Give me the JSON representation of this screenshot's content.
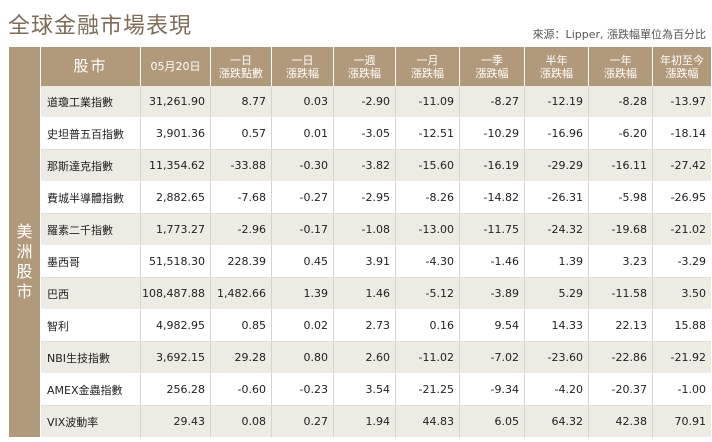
{
  "title": "全球金融市場表現",
  "source": "來源：Lipper, 漲跌幅單位為百分比",
  "region": [
    "美",
    "洲",
    "股",
    "市"
  ],
  "headers": {
    "stock": "股市",
    "date": "05月20日",
    "c1": [
      "一日",
      "漲跌點數"
    ],
    "c2": [
      "一日",
      "漲跌幅"
    ],
    "c3": [
      "一週",
      "漲跌幅"
    ],
    "c4": [
      "一月",
      "漲跌幅"
    ],
    "c5": [
      "一季",
      "漲跌幅"
    ],
    "c6": [
      "半年",
      "漲跌幅"
    ],
    "c7": [
      "一年",
      "漲跌幅"
    ],
    "c8": [
      "年初至今",
      "漲跌幅"
    ]
  },
  "rows": [
    {
      "name": "道瓊工業指數",
      "vals": [
        "31,261.90",
        "8.77",
        "0.03",
        "-2.90",
        "-11.09",
        "-8.27",
        "-12.19",
        "-8.28",
        "-13.97"
      ]
    },
    {
      "name": "史坦普五百指數",
      "vals": [
        "3,901.36",
        "0.57",
        "0.01",
        "-3.05",
        "-12.51",
        "-10.29",
        "-16.96",
        "-6.20",
        "-18.14"
      ]
    },
    {
      "name": "那斯達克指數",
      "vals": [
        "11,354.62",
        "-33.88",
        "-0.30",
        "-3.82",
        "-15.60",
        "-16.19",
        "-29.29",
        "-16.11",
        "-27.42"
      ]
    },
    {
      "name": "費城半導體指數",
      "vals": [
        "2,882.65",
        "-7.68",
        "-0.27",
        "-2.95",
        "-8.26",
        "-14.82",
        "-26.31",
        "-5.98",
        "-26.95"
      ]
    },
    {
      "name": "羅素二千指數",
      "vals": [
        "1,773.27",
        "-2.96",
        "-0.17",
        "-1.08",
        "-13.00",
        "-11.75",
        "-24.32",
        "-19.68",
        "-21.02"
      ]
    },
    {
      "name": "墨西哥",
      "vals": [
        "51,518.30",
        "228.39",
        "0.45",
        "3.91",
        "-4.30",
        "-1.46",
        "1.39",
        "3.23",
        "-3.29"
      ]
    },
    {
      "name": "巴西",
      "vals": [
        "108,487.88",
        "1,482.66",
        "1.39",
        "1.46",
        "-5.12",
        "-3.89",
        "5.29",
        "-11.58",
        "3.50"
      ]
    },
    {
      "name": "智利",
      "vals": [
        "4,982.95",
        "0.85",
        "0.02",
        "2.73",
        "0.16",
        "9.54",
        "14.33",
        "22.13",
        "15.88"
      ]
    },
    {
      "name": "NBI生技指數",
      "vals": [
        "3,692.15",
        "29.28",
        "0.80",
        "2.60",
        "-11.02",
        "-7.02",
        "-23.60",
        "-22.86",
        "-21.92"
      ]
    },
    {
      "name": "AMEX金蟲指數",
      "vals": [
        "256.28",
        "-0.60",
        "-0.23",
        "3.54",
        "-21.25",
        "-9.34",
        "-4.20",
        "-20.37",
        "-1.00"
      ]
    },
    {
      "name": "VIX波動率",
      "vals": [
        "29.43",
        "0.08",
        "0.27",
        "1.94",
        "44.83",
        "6.05",
        "64.32",
        "42.38",
        "70.91"
      ]
    }
  ]
}
